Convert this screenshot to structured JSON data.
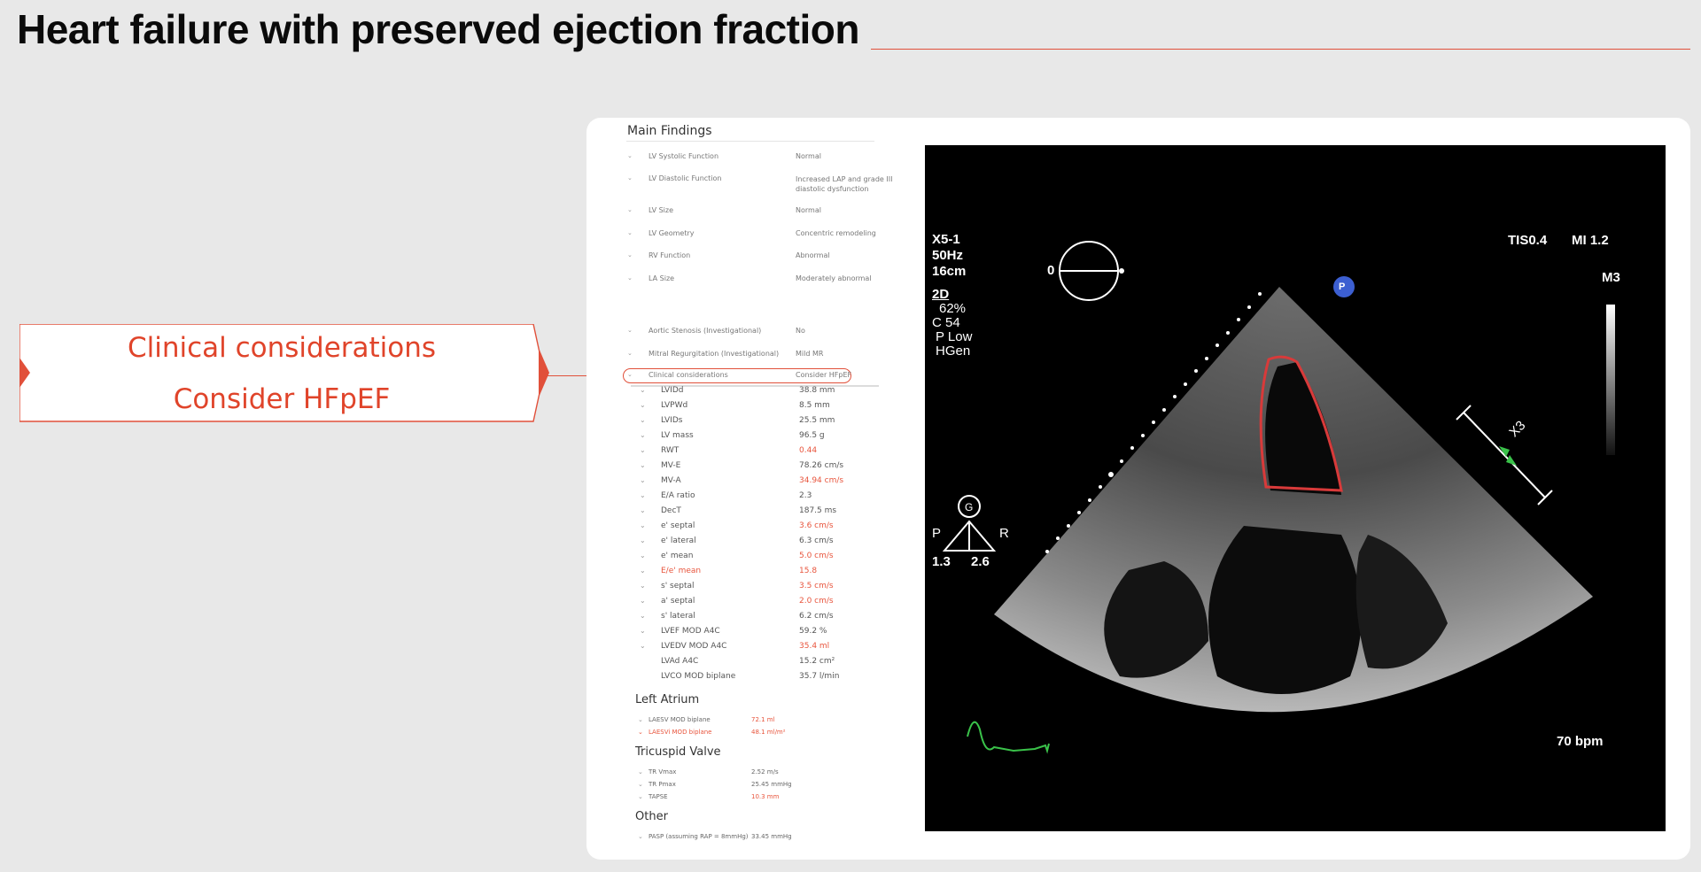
{
  "slide": {
    "title": "Heart failure with preserved ejection fraction",
    "accent_color": "#e1503a"
  },
  "callout": {
    "line1": "Clinical considerations",
    "line2": "Consider HFpEF"
  },
  "findings": {
    "title": "Main Findings",
    "rows": [
      {
        "label": "LV Systolic Function",
        "value": "Normal"
      },
      {
        "label": "LV Diastolic Function",
        "value": "Increased LAP and grade III diastolic dysfunction"
      },
      {
        "label": "LV Size",
        "value": "Normal"
      },
      {
        "label": "LV Geometry",
        "value": "Concentric remodeling"
      },
      {
        "label": "RV Function",
        "value": "Abnormal"
      },
      {
        "label": "LA Size",
        "value": "Moderately abnormal"
      },
      {
        "label": "Aortic Stenosis (Investigational)",
        "value": "No"
      },
      {
        "label": "Mitral Regurgitation (Investigational)",
        "value": "Mild MR"
      },
      {
        "label": "Clinical considerations",
        "value": "Consider HFpEF"
      }
    ]
  },
  "measurements": [
    {
      "label": "LVIDd",
      "value": "38.8 mm",
      "abnormal": false
    },
    {
      "label": "LVPWd",
      "value": "8.5 mm",
      "abnormal": false
    },
    {
      "label": "LVIDs",
      "value": "25.5 mm",
      "abnormal": false
    },
    {
      "label": "LV mass",
      "value": "96.5 g",
      "abnormal": false
    },
    {
      "label": "RWT",
      "value": "0.44",
      "abnormal": true
    },
    {
      "label": "MV-E",
      "value": "78.26 cm/s",
      "abnormal": false
    },
    {
      "label": "MV-A",
      "value": "34.94 cm/s",
      "abnormal": true
    },
    {
      "label": "E/A ratio",
      "value": "2.3",
      "abnormal": false
    },
    {
      "label": "DecT",
      "value": "187.5 ms",
      "abnormal": false
    },
    {
      "label": "e' septal",
      "value": "3.6 cm/s",
      "abnormal": true
    },
    {
      "label": "e' lateral",
      "value": "6.3 cm/s",
      "abnormal": false
    },
    {
      "label": "e' mean",
      "value": "5.0 cm/s",
      "abnormal": true
    },
    {
      "label": "E/e' mean",
      "value": "15.8",
      "abnormal": true,
      "label_abnormal": true
    },
    {
      "label": "s' septal",
      "value": "3.5 cm/s",
      "abnormal": true
    },
    {
      "label": "a' septal",
      "value": "2.0 cm/s",
      "abnormal": true
    },
    {
      "label": "s' lateral",
      "value": "6.2 cm/s",
      "abnormal": false
    },
    {
      "label": "LVEF MOD A4C",
      "value": "59.2 %",
      "abnormal": false
    },
    {
      "label": "LVEDV MOD A4C",
      "value": "35.4 ml",
      "abnormal": true
    },
    {
      "label": "LVAd A4C",
      "value": "15.2 cm²",
      "abnormal": false
    },
    {
      "label": "LVCO MOD biplane",
      "value": "35.7 l/min",
      "abnormal": false
    }
  ],
  "left_atrium": {
    "title": "Left Atrium",
    "rows": [
      {
        "label": "LAESV MOD biplane",
        "value": "72.1 ml"
      },
      {
        "label": "LAESVi MOD biplane",
        "value": "48.1 ml/m²"
      }
    ]
  },
  "tricuspid": {
    "title": "Tricuspid Valve",
    "rows": [
      {
        "label": "TR Vmax",
        "value": "2.52 m/s"
      },
      {
        "label": "TR Pmax",
        "value": "25.45 mmHg"
      },
      {
        "label": "TAPSE",
        "value": "10.3 mm"
      }
    ]
  },
  "other": {
    "title": "Other",
    "rows": [
      {
        "label": "PASP (assuming RAP = 8mmHg)",
        "value": "33.45 mmHg"
      }
    ]
  },
  "echo": {
    "probe": "X5-1",
    "freq": "50Hz",
    "depth": "16cm",
    "mode": "2D",
    "gain": "62%",
    "compress": "C 54",
    "power": "P Low",
    "gen": "HGen",
    "tis": "TIS0.4",
    "mi": "MI 1.2",
    "preset": "M3",
    "angle": "0",
    "zoom": "X3",
    "marker_p": "P",
    "marker_g": "G",
    "focus_p": "P",
    "focus_r": "R",
    "focus_left": "1.3",
    "focus_right": "2.6",
    "heart_rate": "70 bpm",
    "contour_color": "#d83a3a",
    "ecg_color": "#3ac24a"
  }
}
